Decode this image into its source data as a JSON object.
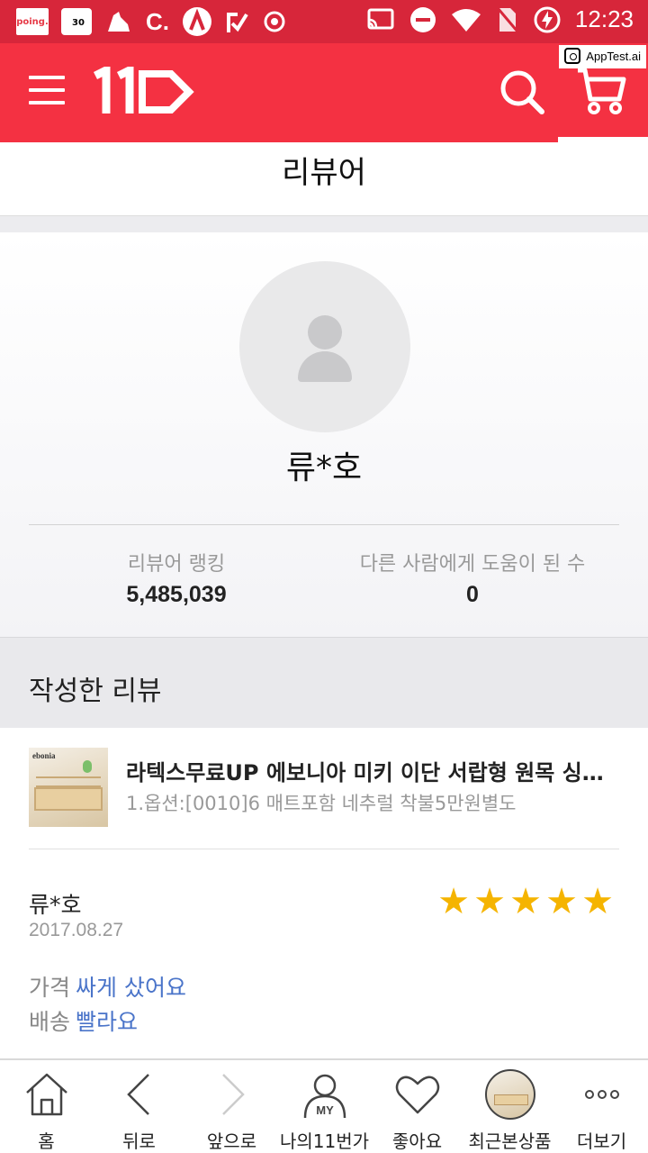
{
  "status_bar": {
    "time": "12:23",
    "poing_label": "poing.",
    "calendar_day": "30",
    "c_label": "C."
  },
  "header": {
    "apptest_label": "AppTest.ai",
    "logo_text": "11"
  },
  "page": {
    "title": "리뷰어"
  },
  "profile": {
    "name": "류*호",
    "ranking_label": "리뷰어 랭킹",
    "ranking_value": "5,485,039",
    "helpful_label": "다른 사람에게 도움이 된 수",
    "helpful_value": "0"
  },
  "section": {
    "title": "작성한 리뷰"
  },
  "product": {
    "brand": "ebonia",
    "title": "라텍스무료UP 에보니아 미키 이단 서랍형 원목 싱글 침대",
    "option": "1.옵션:[0010]6 매트포함 네추럴 착불5만원별도"
  },
  "review": {
    "author": "류*호",
    "date": "2017.08.27",
    "rating": 5,
    "attributes": [
      {
        "key": "가격",
        "value": "싸게 샀어요"
      },
      {
        "key": "배송",
        "value": "빨라요"
      }
    ]
  },
  "bottom_nav": [
    {
      "label": "홈",
      "icon": "home-icon"
    },
    {
      "label": "뒤로",
      "icon": "back-icon"
    },
    {
      "label": "앞으로",
      "icon": "forward-icon"
    },
    {
      "label": "나의11번가",
      "icon": "my-icon",
      "badge": "MY"
    },
    {
      "label": "좋아요",
      "icon": "heart-icon"
    },
    {
      "label": "최근본상품",
      "icon": "recent-product-thumb"
    },
    {
      "label": "더보기",
      "icon": "more-icon"
    }
  ],
  "colors": {
    "brand_red": "#f43142",
    "status_red": "#d7263a",
    "star": "#f5b400",
    "link_blue": "#4a74c9"
  }
}
